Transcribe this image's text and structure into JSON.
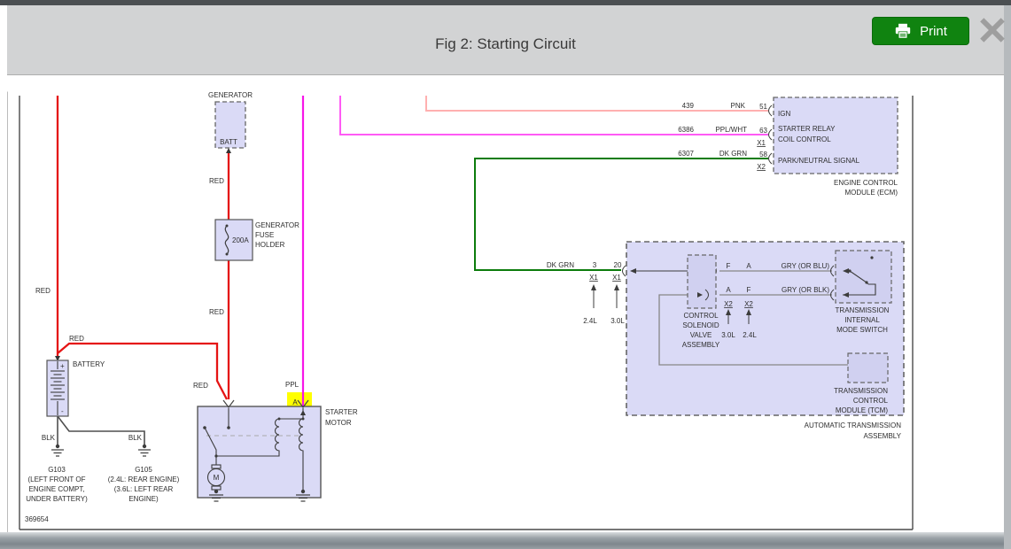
{
  "window": {
    "title": "Fig 2: Starting Circuit",
    "print_button": "Print"
  },
  "figure_number": "369654",
  "wire_labels": {
    "red": "RED",
    "blk": "BLK",
    "ppl": "PPL",
    "pnk": "PNK",
    "ppl_wht": "PPL/WHT",
    "dk_grn": "DK GRN",
    "gry_blu": "GRY (OR BLU)",
    "gry_blk": "GRY (OR BLK)",
    "num_439": "439",
    "num_6386": "6386",
    "num_6307": "6307"
  },
  "components": {
    "generator": {
      "label": "GENERATOR",
      "terminal": "BATT"
    },
    "generator_fuse": {
      "line1": "GENERATOR",
      "line2": "FUSE",
      "line3": "HOLDER",
      "rating": "200A"
    },
    "battery": {
      "label": "BATTERY",
      "plus": "+",
      "minus": "-"
    },
    "starter_motor": {
      "line1": "STARTER",
      "line2": "MOTOR",
      "terminal_a": "A",
      "motor": "M"
    },
    "ground_g103": {
      "id": "G103",
      "desc1": "(LEFT FRONT OF",
      "desc2": "ENGINE COMPT,",
      "desc3": "UNDER BATTERY)"
    },
    "ground_g105": {
      "id": "G105",
      "desc1": "(2.4L: REAR ENGINE)",
      "desc2": "(3.6L: LEFT REAR",
      "desc3": "ENGINE)"
    },
    "ecm": {
      "pin_51": "51",
      "pin_63": "63",
      "pin_58": "58",
      "conn_x1": "X1",
      "conn_x2": "X2",
      "sig_ign": "IGN",
      "sig_relay1": "STARTER RELAY",
      "sig_relay2": "COIL CONTROL",
      "sig_pnp": "PARK/NEUTRAL SIGNAL",
      "name1": "ENGINE CONTROL",
      "name2": "MODULE (ECM)"
    },
    "trans_conn": {
      "pin_3": "3",
      "pin_20": "20",
      "conn_x1": "X1",
      "eng_24": "2.4L",
      "eng_30": "3.0L"
    },
    "solenoid": {
      "pin_f": "F",
      "pin_a": "A",
      "conn_x2": "X2",
      "eng_30": "3.0L",
      "eng_24": "2.4L",
      "name1": "CONTROL",
      "name2": "SOLENOID",
      "name3": "VALVE",
      "name4": "ASSEMBLY"
    },
    "mode_switch": {
      "name1": "TRANSMISSION",
      "name2": "INTERNAL",
      "name3": "MODE SWITCH"
    },
    "tcm": {
      "name1": "TRANSMISSION",
      "name2": "CONTROL",
      "name3": "MODULE (TCM)"
    },
    "assembly": {
      "name1": "AUTOMATIC TRANSMISSION",
      "name2": "ASSEMBLY"
    }
  },
  "colors": {
    "print_green": "#108310",
    "titlebar_gray": "#d2d3d4",
    "wire_red": "#e51414",
    "wire_pink": "#ffb0b0",
    "wire_purple": "#f716e8",
    "wire_purple_white": "#ff5af5",
    "wire_dark_green": "#0c7c0c",
    "wire_gray": "#878787",
    "wire_black": "#4f4f4f",
    "terminal_highlight": "#ffff00",
    "component_fill": "#dadaf6",
    "component_fill_inner": "#d0d0f0"
  }
}
